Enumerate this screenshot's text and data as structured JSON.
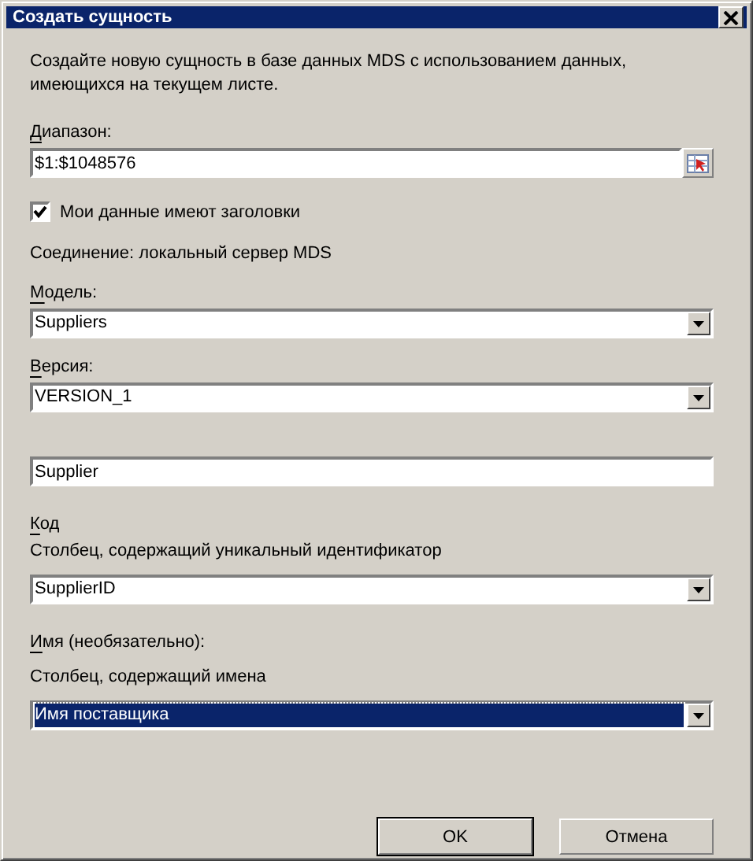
{
  "window": {
    "title": "Создать сущность"
  },
  "description": "Создайте новую сущность в базе данных MDS с использованием данных, имеющихся на текущем листе.",
  "range": {
    "label": "Диапазон:",
    "mnemonic": true,
    "value": "$1:$1048576"
  },
  "has_headers": {
    "label": "Мои данные имеют заголовки",
    "checked": true
  },
  "connection": "Соединение: локальный сервер MDS",
  "model": {
    "label": "Модель:",
    "mnemonic": true,
    "value": "Suppliers",
    "selected": false
  },
  "version": {
    "label": "Версия:",
    "mnemonic": true,
    "value": "VERSION_1",
    "selected": false
  },
  "entity_name": {
    "value": "Supplier"
  },
  "code": {
    "label": "Код",
    "mnemonic": true,
    "hint": "Столбец, содержащий уникальный идентификатор",
    "value": "SupplierID",
    "selected": false
  },
  "name": {
    "label": "Имя (необязательно):",
    "mnemonic": true,
    "hint": "Столбец, содержащий имена",
    "value": "Имя поставщика",
    "selected": true
  },
  "buttons": [
    {
      "label": "OK",
      "default": true
    },
    {
      "label": "Отмена",
      "default": false
    }
  ]
}
